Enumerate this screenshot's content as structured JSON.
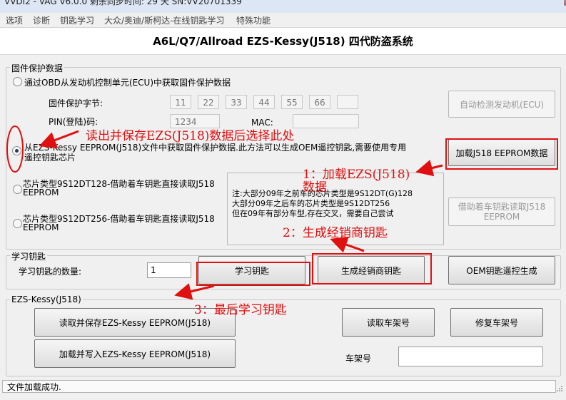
{
  "titlebar": {
    "text": "VVDI2 - VAG V6.0.0      剩余同步时间: 29 天      SN:VV20701339"
  },
  "menu": {
    "items": [
      "选项",
      "诊断",
      "钥匙学习",
      "大众/奥迪/斯柯达-在线钥匙学习",
      "特殊功能"
    ]
  },
  "header": {
    "title": "A6L/Q7/Allroad EZS-Kessy(J518) 四代防盗系统"
  },
  "firmware_group": {
    "label": "固件保护数据",
    "obd_option": "通过OBD从发动机控制单元(ECU)中获取固件保护数据",
    "bytes_label": "固件保护字节:",
    "bytes": [
      "11",
      "22",
      "33",
      "44",
      "55",
      "66",
      ""
    ],
    "pin_label": "PIN(登陆)码:",
    "pin_value": "1234",
    "mac_label": "MAC:",
    "mac_value": "",
    "auto_detect_button": "自动检测发动机(ECU)",
    "eeprom_option_line1": "从EZS-Kessy EEPROM(J518)文件中获取固件保护数据.此方法可以生成OEM遥控钥匙,需要使用专用",
    "eeprom_option_line2": "遥控钥匙芯片",
    "load_eeprom_button": "加载J518 EEPROM数据",
    "chip128_line1": "芯片类型9S12DT128-借助着车钥匙直接读取J518",
    "chip128_line2": "EEPROM",
    "chip256_line1": "芯片类型9S12DT256-借助着车钥匙直接读取J518",
    "chip256_line2": "EEPROM",
    "note_lines": [
      "注:大部分09年之前车的芯片类型是9S12DT(G)128",
      "大部分09年之后车的芯片类型是9S12DT256",
      "但在09年有部分车型,存在交叉，需要自己尝试"
    ],
    "read_via_key_button_line1": "借助着车钥匙读取J518",
    "read_via_key_button_line2": "EEPROM"
  },
  "learn_group": {
    "label": "学习钥匙",
    "count_label": "学习钥匙的数量:",
    "count_value": "1",
    "learn_button": "学习钥匙",
    "dealer_key_button": "生成经销商钥匙",
    "oem_remote_button": "OEM钥匙遥控生成"
  },
  "ezs_group": {
    "label": "EZS-Kessy(J518)",
    "read_save_button": "读取并保存EZS-Kessy EEPROM(J518)",
    "load_write_button": "加载并写入EZS-Kessy EEPROM(J518)",
    "read_vin_button": "读取车架号",
    "repair_vin_button": "修复车架号",
    "vin_label": "车架号",
    "vin_value": ""
  },
  "annotations": {
    "step0": "读出并保存EZS(J518)数据后选择此处",
    "step1_line1": "1：加载EZS(J518)",
    "step1_line2": "数据",
    "step2": "2：生成经销商钥匙",
    "step3": "3：最后学习钥匙"
  },
  "status": {
    "text": "文件加载成功."
  },
  "colors": {
    "annotation_red": "#e01010",
    "radio_checked": "#1e3c72"
  }
}
